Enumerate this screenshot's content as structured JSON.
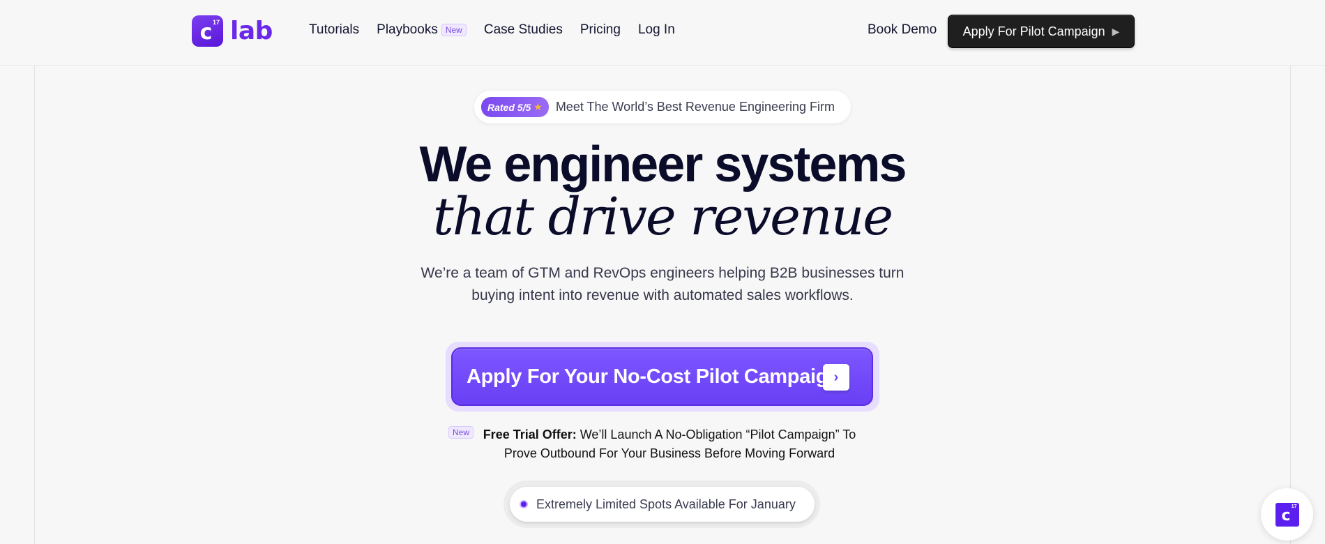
{
  "header": {
    "logo": {
      "mark_letter": "c",
      "mark_superscript": "17",
      "text": "lab"
    },
    "nav": [
      {
        "label": "Tutorials"
      },
      {
        "label": "Playbooks",
        "badge": "New"
      },
      {
        "label": "Case Studies"
      },
      {
        "label": "Pricing"
      },
      {
        "label": "Log In"
      }
    ],
    "book_demo": "Book Demo",
    "apply_button": "Apply For Pilot Campaign",
    "apply_icon": "play-icon"
  },
  "hero": {
    "rated_badge": "Rated 5/5",
    "rated_icon": "star-icon",
    "rated_text": "Meet The World’s Best Revenue Engineering Firm",
    "headline": "We engineer systems",
    "headline_italic": "that drive revenue",
    "subtitle": "We’re a team of GTM and RevOps engineers helping B2B businesses turn buying intent into revenue with automated sales workflows.",
    "cta_label": "Apply For Your No-Cost Pilot Campaign",
    "cta_icon": "chevron-right-icon",
    "offer_badge": "New",
    "offer_bold": "Free Trial Offer:",
    "offer_text": "We’ll Launch A No-Obligation “Pilot Campaign” To Prove Outbound For Your Business Before Moving Forward",
    "spots_text": "Extremely Limited Spots Available For January"
  },
  "chat_widget": {
    "mark_letter": "c",
    "mark_superscript": "17"
  },
  "colors": {
    "brand": "#6a28e8",
    "cta": "#6a3ff5",
    "dark_button": "#1f1f1f",
    "background": "#f7f7f7"
  }
}
